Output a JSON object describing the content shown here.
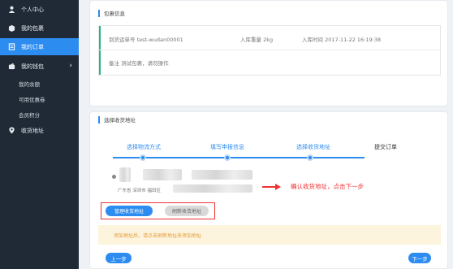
{
  "sidebar": {
    "items": [
      {
        "label": "个人中心",
        "icon": "user-icon"
      },
      {
        "label": "我的包裹",
        "icon": "package-icon"
      },
      {
        "label": "我的订单",
        "icon": "order-icon"
      },
      {
        "label": "我的钱包",
        "icon": "wallet-icon"
      },
      {
        "label": "收货地址",
        "icon": "location-icon"
      }
    ],
    "wallet_subitems": [
      "我的余额",
      "可用优惠卷",
      "会员积分"
    ]
  },
  "package_info": {
    "title": "包裹信息",
    "tracking_label": "到货运单号",
    "tracking_value": "test-wudan00001",
    "weight_label": "入库重量",
    "weight_value": "2kg",
    "time_label": "入库时间",
    "time_value": "2017-11-22 16:19:38",
    "remark_label": "备注",
    "remark_value": "测试包裹，请勿操作"
  },
  "address_section": {
    "title": "选择收货地址",
    "steps": [
      "选择物流方式",
      "填写申报信息",
      "选择收货地址",
      "提交订单"
    ],
    "address_region": "广东省  深圳市  福田区",
    "annotation": "确认收货地址，点击下一步",
    "manage_button": "管理收货地址",
    "refresh_button": "刷新收货地址",
    "notice": "添加地址后，请点击刷新地址来添加地址",
    "prev_button": "上一步",
    "next_button": "下一步"
  },
  "colors": {
    "sidebar_bg": "#1f2a36",
    "accent": "#2d8cf0",
    "annotation_red": "#e33333",
    "notice_bg": "#fdf4dd",
    "notice_text": "#e69b3a"
  }
}
